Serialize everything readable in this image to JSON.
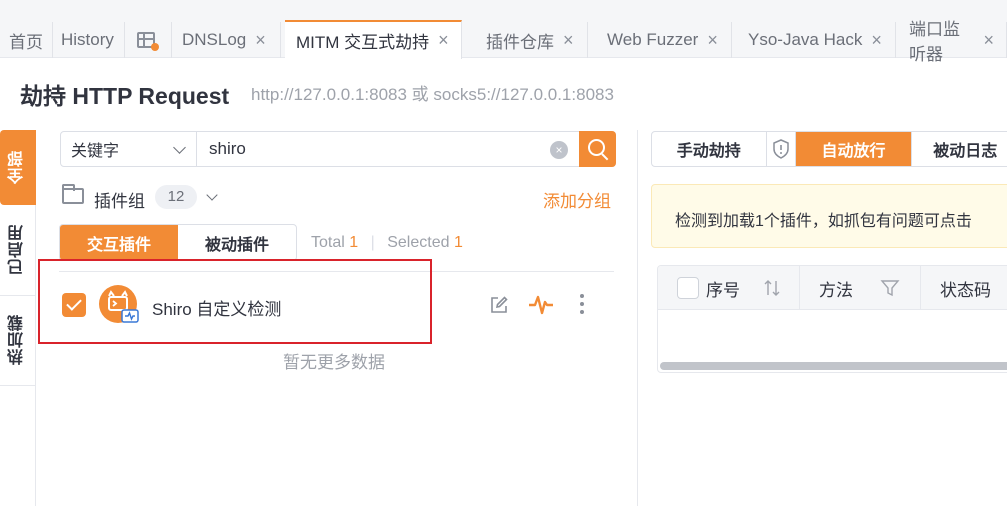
{
  "tabs": [
    {
      "label": "首页"
    },
    {
      "label": "History"
    },
    {
      "label": "",
      "icon": "table-icon"
    },
    {
      "label": "DNSLog",
      "close": "×"
    },
    {
      "label": "MITM 交互式劫持",
      "close": "×",
      "active": true
    },
    {
      "label": "插件仓库",
      "close": "×"
    },
    {
      "label": "Web Fuzzer",
      "close": "×"
    },
    {
      "label": "Yso-Java Hack",
      "close": "×"
    },
    {
      "label": "端口监听器",
      "close": "×"
    }
  ],
  "header": {
    "title": "劫持 HTTP Request",
    "subtitle": "http://127.0.0.1:8083 或 socks5://127.0.0.1:8083"
  },
  "side_tabs": [
    "全部",
    "已启用",
    "热加载"
  ],
  "search": {
    "filter": "关键字",
    "value": "shiro",
    "clear": "×"
  },
  "plugin_group": {
    "label": "插件组",
    "count": "12",
    "add_label": "添加分组"
  },
  "plugin_tabs": {
    "interactive": "交互插件",
    "passive": "被动插件"
  },
  "stats": {
    "total_label": "Total",
    "total": "1",
    "selected_label": "Selected",
    "selected": "1"
  },
  "plugins": [
    {
      "name": "Shiro 自定义检测",
      "checked": true
    }
  ],
  "empty_text": "暂无更多数据",
  "right": {
    "modes": [
      "手动劫持",
      "自动放行",
      "被动日志"
    ],
    "active_mode": "自动放行",
    "alert": "检测到加载1个插件，如抓包有问题可点击",
    "columns": [
      "序号",
      "方法",
      "状态码"
    ]
  },
  "colors": {
    "accent": "#f28b35",
    "highlight_border": "#d9232b"
  }
}
